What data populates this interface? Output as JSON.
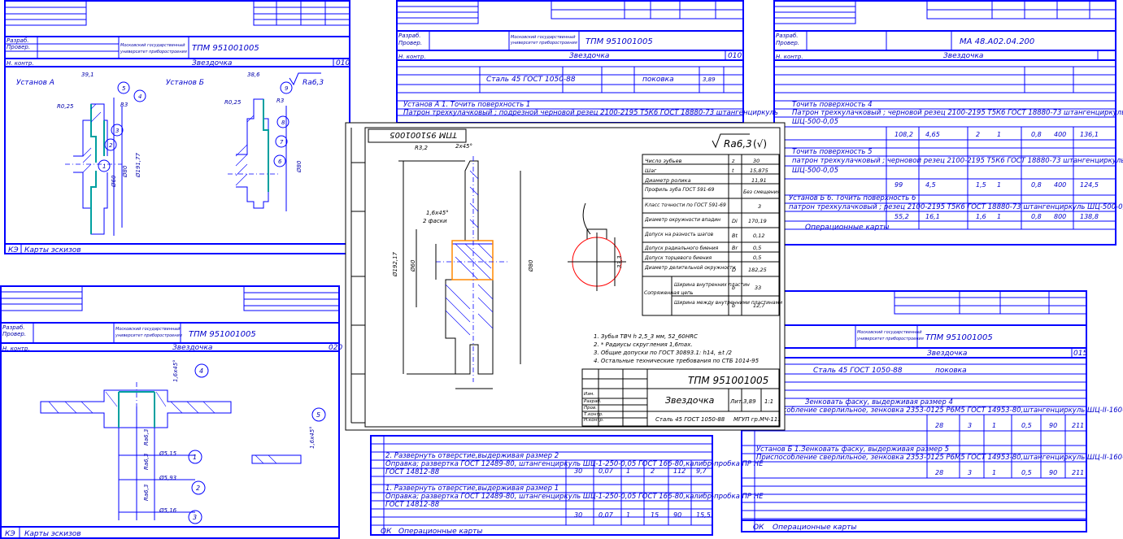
{
  "sheets": {
    "tl": {
      "org": "Московский государственный\nуниверситет приборостроения",
      "code": "ТПМ 951001005",
      "part": "Звездочка",
      "num": "010",
      "setup_a": "Установ А",
      "setup_b": "Установ Б",
      "rough": "Ra6,3",
      "footer_code": "КЭ",
      "footer": "Карты эскизов",
      "dims": [
        "39,1",
        "38,6",
        "R0,25",
        "R0,25",
        "R3",
        "R3",
        "Ø80",
        "Ø60",
        "Ø191,77",
        "Ø80"
      ],
      "balloons": [
        "5",
        "4",
        "3",
        "2",
        "1",
        "9",
        "8",
        "7",
        "6"
      ],
      "rows": [
        "Разраб.",
        "Провер.",
        "Н. контр."
      ]
    },
    "top_mid": {
      "code": "ТПМ 951001005",
      "part": "Звездочка",
      "num": "010",
      "material": "Сталь 45 ГОСТ 1050-88",
      "blank": "поковка",
      "mass": "3,89",
      "op1": "Установ А  1. Точить поверхность 1",
      "op2": "Патрон трехкулачковый ; подрезной черновой резец 2100-2195 Т5К6 ГОСТ 18880-73 штангенциркуль"
    },
    "top_right": {
      "code": "МА 48.А02.04.200",
      "part": "Звездочка",
      "op1": "Точить поверхность 4",
      "op1b": "Патрон трехкулачковый ; черновой резец 2100-2195 Т5К6 ГОСТ 18880-73 штангенциркуль",
      "op1c": "ШЦ-500-0,05",
      "op2": "Точить поверхность 5",
      "op2b": "патрон трехкулачковый ; черновой резец 2100-2195 Т5К6 ГОСТ 18880-73 штангенциркуль",
      "op2c": "ШЦ-500-0,05",
      "op3": "Установ Б 6. Точить поверхность 6",
      "op3b": "патрон трехкулачковый ; резец 2100-2195 Т5К6 ГОСТ 18880-73 штангенциркуль ШЦ-500-0,05",
      "footer": "Операционные карты",
      "vals1": [
        "108,2",
        "4,65",
        "2",
        "1",
        "0,8",
        "400",
        "136,1"
      ],
      "vals2": [
        "99",
        "4,5",
        "1,5",
        "1",
        "0,8",
        "400",
        "124,5"
      ],
      "vals3": [
        "55,2",
        "16,1",
        "1,6",
        "1",
        "0,8",
        "800",
        "138,8"
      ]
    },
    "center": {
      "stamp_top": "ТПМ 951001005",
      "stamp_code": "ТПМ 951001005",
      "title": "Звездочка",
      "material": "Сталь 45 ГОСТ 1050-88",
      "mass": "3,89",
      "scale": "1:1",
      "group": "МГУП гр.МЧ-111",
      "rough": "Ra6,3",
      "params": [
        [
          "Число зубьев",
          "z",
          "30"
        ],
        [
          "Шаг",
          "t",
          "15,875"
        ],
        [
          "Диаметр ролика",
          "",
          "11,91"
        ],
        [
          "Профиль зуба ГОСТ 591-69",
          "",
          "Без смещения"
        ],
        [
          "Класс точности по ГОСТ 591-69",
          "",
          "3"
        ],
        [
          "Диаметр окружности впадин",
          "Di",
          "170,19"
        ],
        [
          "Допуск на разность шагов",
          "Bt",
          "0,12"
        ],
        [
          "Допуск радиального биения",
          "Br",
          "0,5"
        ],
        [
          "Допуск торцевого биения",
          "",
          "0,5"
        ],
        [
          "Диаметр делительной окружности",
          "D",
          "182,25"
        ],
        [
          "Ширина внутренних пластин",
          "b",
          "33"
        ],
        [
          "Ширина между внутренними пластинами",
          "b",
          "12,7"
        ]
      ],
      "group_label": "Сопряженная цепь",
      "notes": [
        "1. Зубья ТВЧ h 2,5_3 мм, 52_60HRC",
        "2. * Радиусы скругления 1,6max.",
        "3. Общие допуски по ГОСТ 30893.1: h14, ±t /2",
        "4. Остальные технические требования по СТБ 1014-95"
      ],
      "dims": [
        "R3,2",
        "2x45°",
        "1,6х45°",
        "2 фаски",
        "Ø60",
        "Ø80",
        "Ø192,17"
      ],
      "roles": [
        "Изм.",
        "Разраб.",
        "Пров.",
        "Т.контр.",
        "Н.контр.",
        "Утв."
      ]
    },
    "bl": {
      "code": "ТПМ 951001005",
      "part": "Звездочка",
      "num": "020",
      "footer_code": "КЭ",
      "footer": "Карты эскизов",
      "dims": [
        "1,6х45°",
        "1,6х45°",
        "Ø5,15",
        "Ø5,93",
        "Ø5,16",
        "Ra6,3",
        "Ra6,3",
        "Ra6,3"
      ],
      "balloons": [
        "4",
        "1",
        "2",
        "3",
        "5"
      ]
    },
    "bottom_mid": {
      "op1": "2. Развернуть отверстие,выдерживая размер 2",
      "op1b": "Оправка; развертка ГОСТ 12489-80, штангенциркуль ШЦ-1-250-0,05 ГОСТ 166-80,калибр-пробка ПР НЕ",
      "op1c": "ГОСТ 14812-88",
      "op2": "1. Развернуть отверстие,выдерживая размер 1",
      "op2b": "Оправка; развертка ГОСТ 12489-80, штангенциркуль ШЦ-1-250-0,05 ГОСТ 166-80,калибр-пробка ПР НЕ",
      "op2c": "ГОСТ 14812-88",
      "vals1": [
        "30",
        "0,07",
        "1",
        "2",
        "112",
        "9,7"
      ],
      "vals2": [
        "30",
        "0,07",
        "1",
        "15",
        "90",
        "15,5"
      ],
      "footer_code": "ОК",
      "footer": "Операционные карты"
    },
    "bottom_right": {
      "code": "ТПМ 951001005",
      "part": "Звездочка",
      "num": "015",
      "material": "Сталь 45 ГОСТ 1050-88",
      "blank": "поковка",
      "op1": "Зенковать  фаску, выдерживая размер 4",
      "op1b": "Приспособление сверлильное, зенковка 2353-0125 Р6М5 ГОСТ 14953-80,штангенциркуль ШЦ-II-160-0,1-2 ГОСТ 166-89",
      "op2": "Установ Б 1.Зенковать  фаску, выдерживая размер 5",
      "op2b": "Приспособление сверлильное, зенковка 2353-0125 Р6М5 ГОСТ 14953-80,штангенциркуль ШЦ-II-160-0,1-2 ГОСТ 166-89",
      "vals": [
        "28",
        "3",
        "1",
        "0,5",
        "90",
        "211"
      ],
      "footer_code": "ОК",
      "footer": "Операционные карты"
    }
  }
}
